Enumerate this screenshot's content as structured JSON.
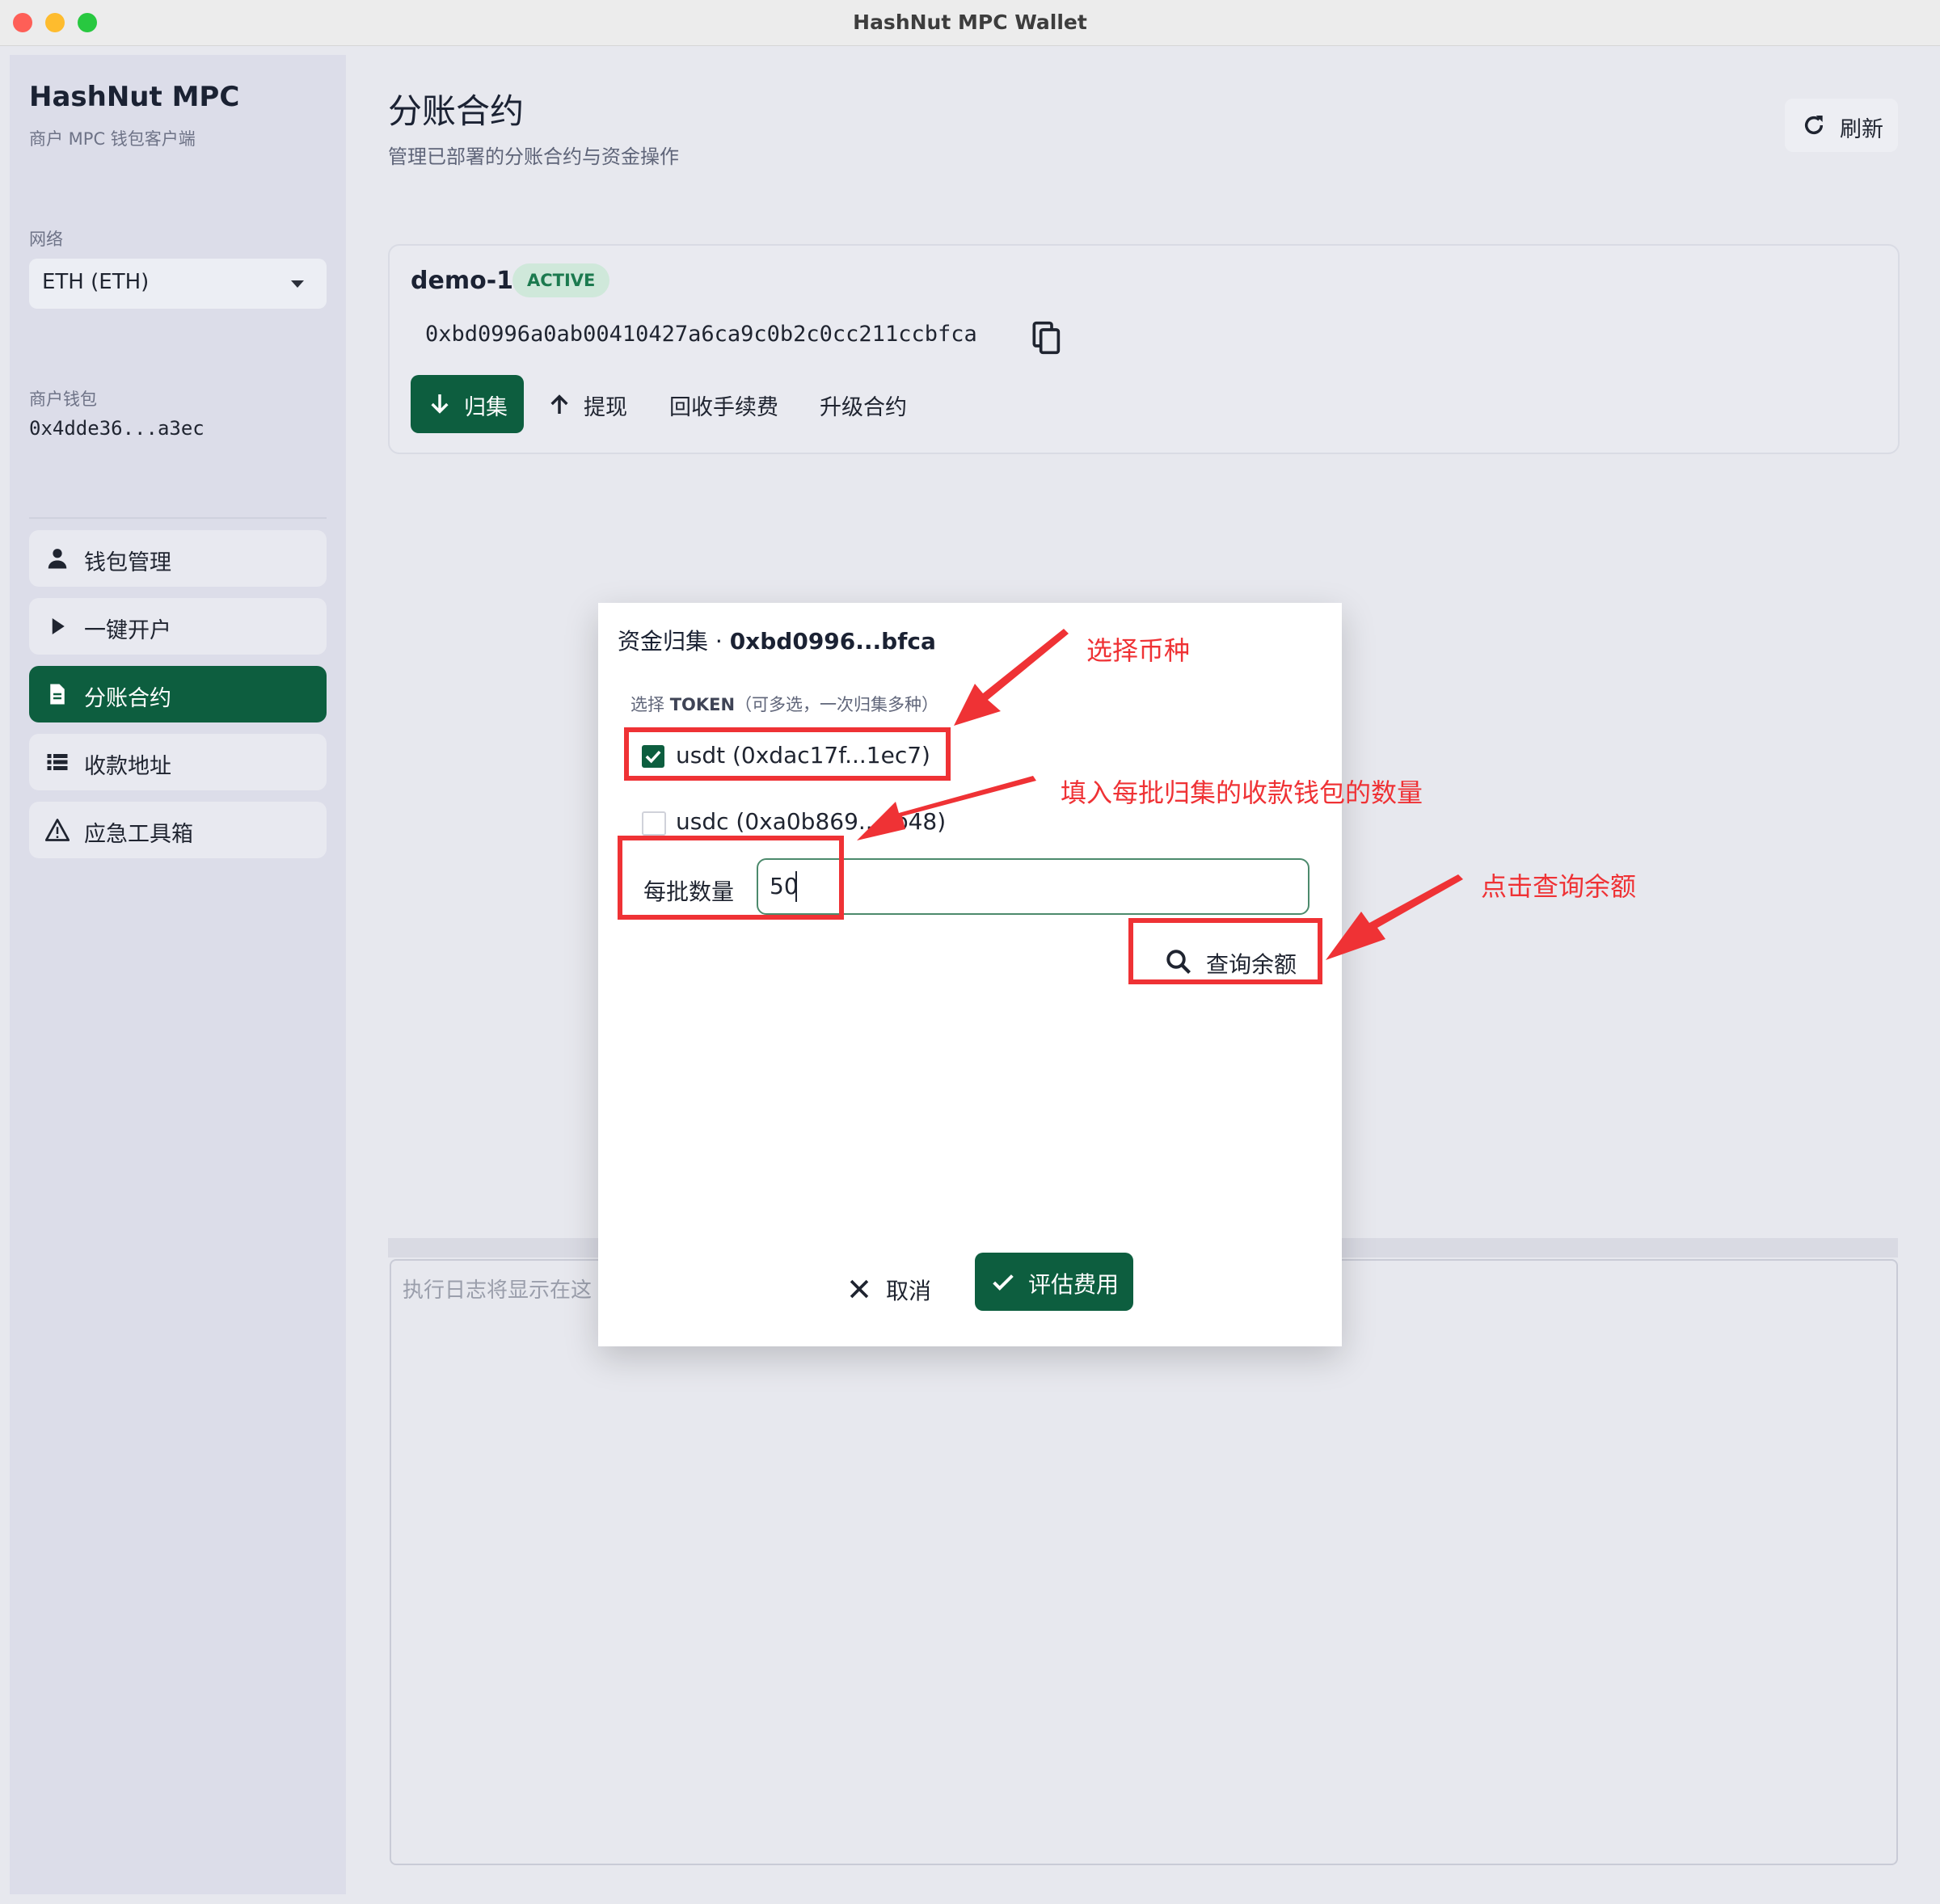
{
  "window": {
    "title": "HashNut MPC Wallet"
  },
  "sidebar": {
    "brand_title": "HashNut MPC",
    "brand_subtitle": "商户 MPC 钱包客户端",
    "network_label": "网络",
    "network_value": "ETH (ETH)",
    "wallet_label": "商户钱包",
    "wallet_address": "0x4dde36...a3ec",
    "items": [
      {
        "label": "钱包管理",
        "icon": "person-icon",
        "active": false
      },
      {
        "label": "一键开户",
        "icon": "play-icon",
        "active": false
      },
      {
        "label": "分账合约",
        "icon": "document-icon",
        "active": true
      },
      {
        "label": "收款地址",
        "icon": "list-icon",
        "active": false
      },
      {
        "label": "应急工具箱",
        "icon": "warning-icon",
        "active": false
      }
    ]
  },
  "header": {
    "title": "分账合约",
    "subtitle": "管理已部署的分账合约与资金操作",
    "refresh_label": "刷新"
  },
  "contract": {
    "name": "demo-1",
    "status": "ACTIVE",
    "address": "0xbd0996a0ab00410427a6ca9c0b2c0cc211ccbfca",
    "actions": {
      "collect": "归集",
      "withdraw": "提现",
      "reclaim_fee": "回收手续费",
      "upgrade": "升级合约"
    }
  },
  "log": {
    "placeholder": "执行日志将显示在这"
  },
  "dialog": {
    "title_prefix": "资金归集 · ",
    "title_address": "0xbd0996...bfca",
    "token_label_prefix": "选择 ",
    "token_label_bold": "TOKEN",
    "token_label_suffix": "（可多选，一次归集多种）",
    "tokens": [
      {
        "label": "usdt (0xdac17f...1ec7)",
        "checked": true
      },
      {
        "label": "usdc (0xa0b869...eb48)",
        "checked": false
      }
    ],
    "batch_label": "每批数量",
    "batch_value": "50",
    "query_label": "查询余额",
    "cancel_label": "取消",
    "estimate_label": "评估费用"
  },
  "annotations": {
    "select_token": "选择币种",
    "fill_batch": "填入每批归集的收款钱包的数量",
    "click_query": "点击查询余额",
    "color": "#ef3235"
  },
  "colors": {
    "primary": "#0d5e3f",
    "badge_bg": "#cfe8da",
    "badge_text": "#1c7a4f",
    "annotation": "#ef3235"
  }
}
